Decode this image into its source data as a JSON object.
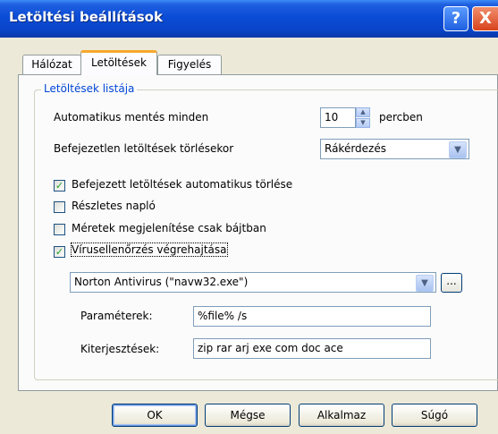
{
  "window": {
    "title": "Letöltési beállítások",
    "help_label": "?",
    "close_label": "X"
  },
  "tabs": [
    {
      "label": "Hálózat",
      "active": false
    },
    {
      "label": "Letöltések",
      "active": true
    },
    {
      "label": "Figyelés",
      "active": false
    }
  ],
  "group": {
    "legend": "Letöltések listája"
  },
  "autosave": {
    "label": "Automatikus mentés minden",
    "value": "10",
    "unit": "percben"
  },
  "incomplete": {
    "label": "Befejezetlen letöltések törlésekor",
    "selected": "Rákérdezés"
  },
  "checkboxes": [
    {
      "label": "Befejezett letöltések automatikus törlése",
      "checked": true,
      "mark": "✓"
    },
    {
      "label": "Részletes napló",
      "checked": false,
      "mark": ""
    },
    {
      "label": "Méretek megjelenítése csak bájtban",
      "checked": false,
      "mark": ""
    },
    {
      "label": "Vírusellenőrzés végrehajtása",
      "checked": true,
      "mark": "✓"
    }
  ],
  "antivirus": {
    "selected": "Norton Antivirus (\"navw32.exe\")",
    "browse_label": "..."
  },
  "parameters": {
    "label": "Paraméterek:",
    "value": "%file% /s"
  },
  "extensions": {
    "label": "Kiterjesztések:",
    "value": "zip rar arj exe com doc ace"
  },
  "buttons": {
    "ok": "OK",
    "cancel": "Mégse",
    "apply": "Alkalmaz",
    "help": "Súgó"
  },
  "colors": {
    "titlebar": "#0a4cd6",
    "group_legend": "#0046d5",
    "check_mark": "#21a121",
    "tab_active_accent": "#f7a82d"
  }
}
